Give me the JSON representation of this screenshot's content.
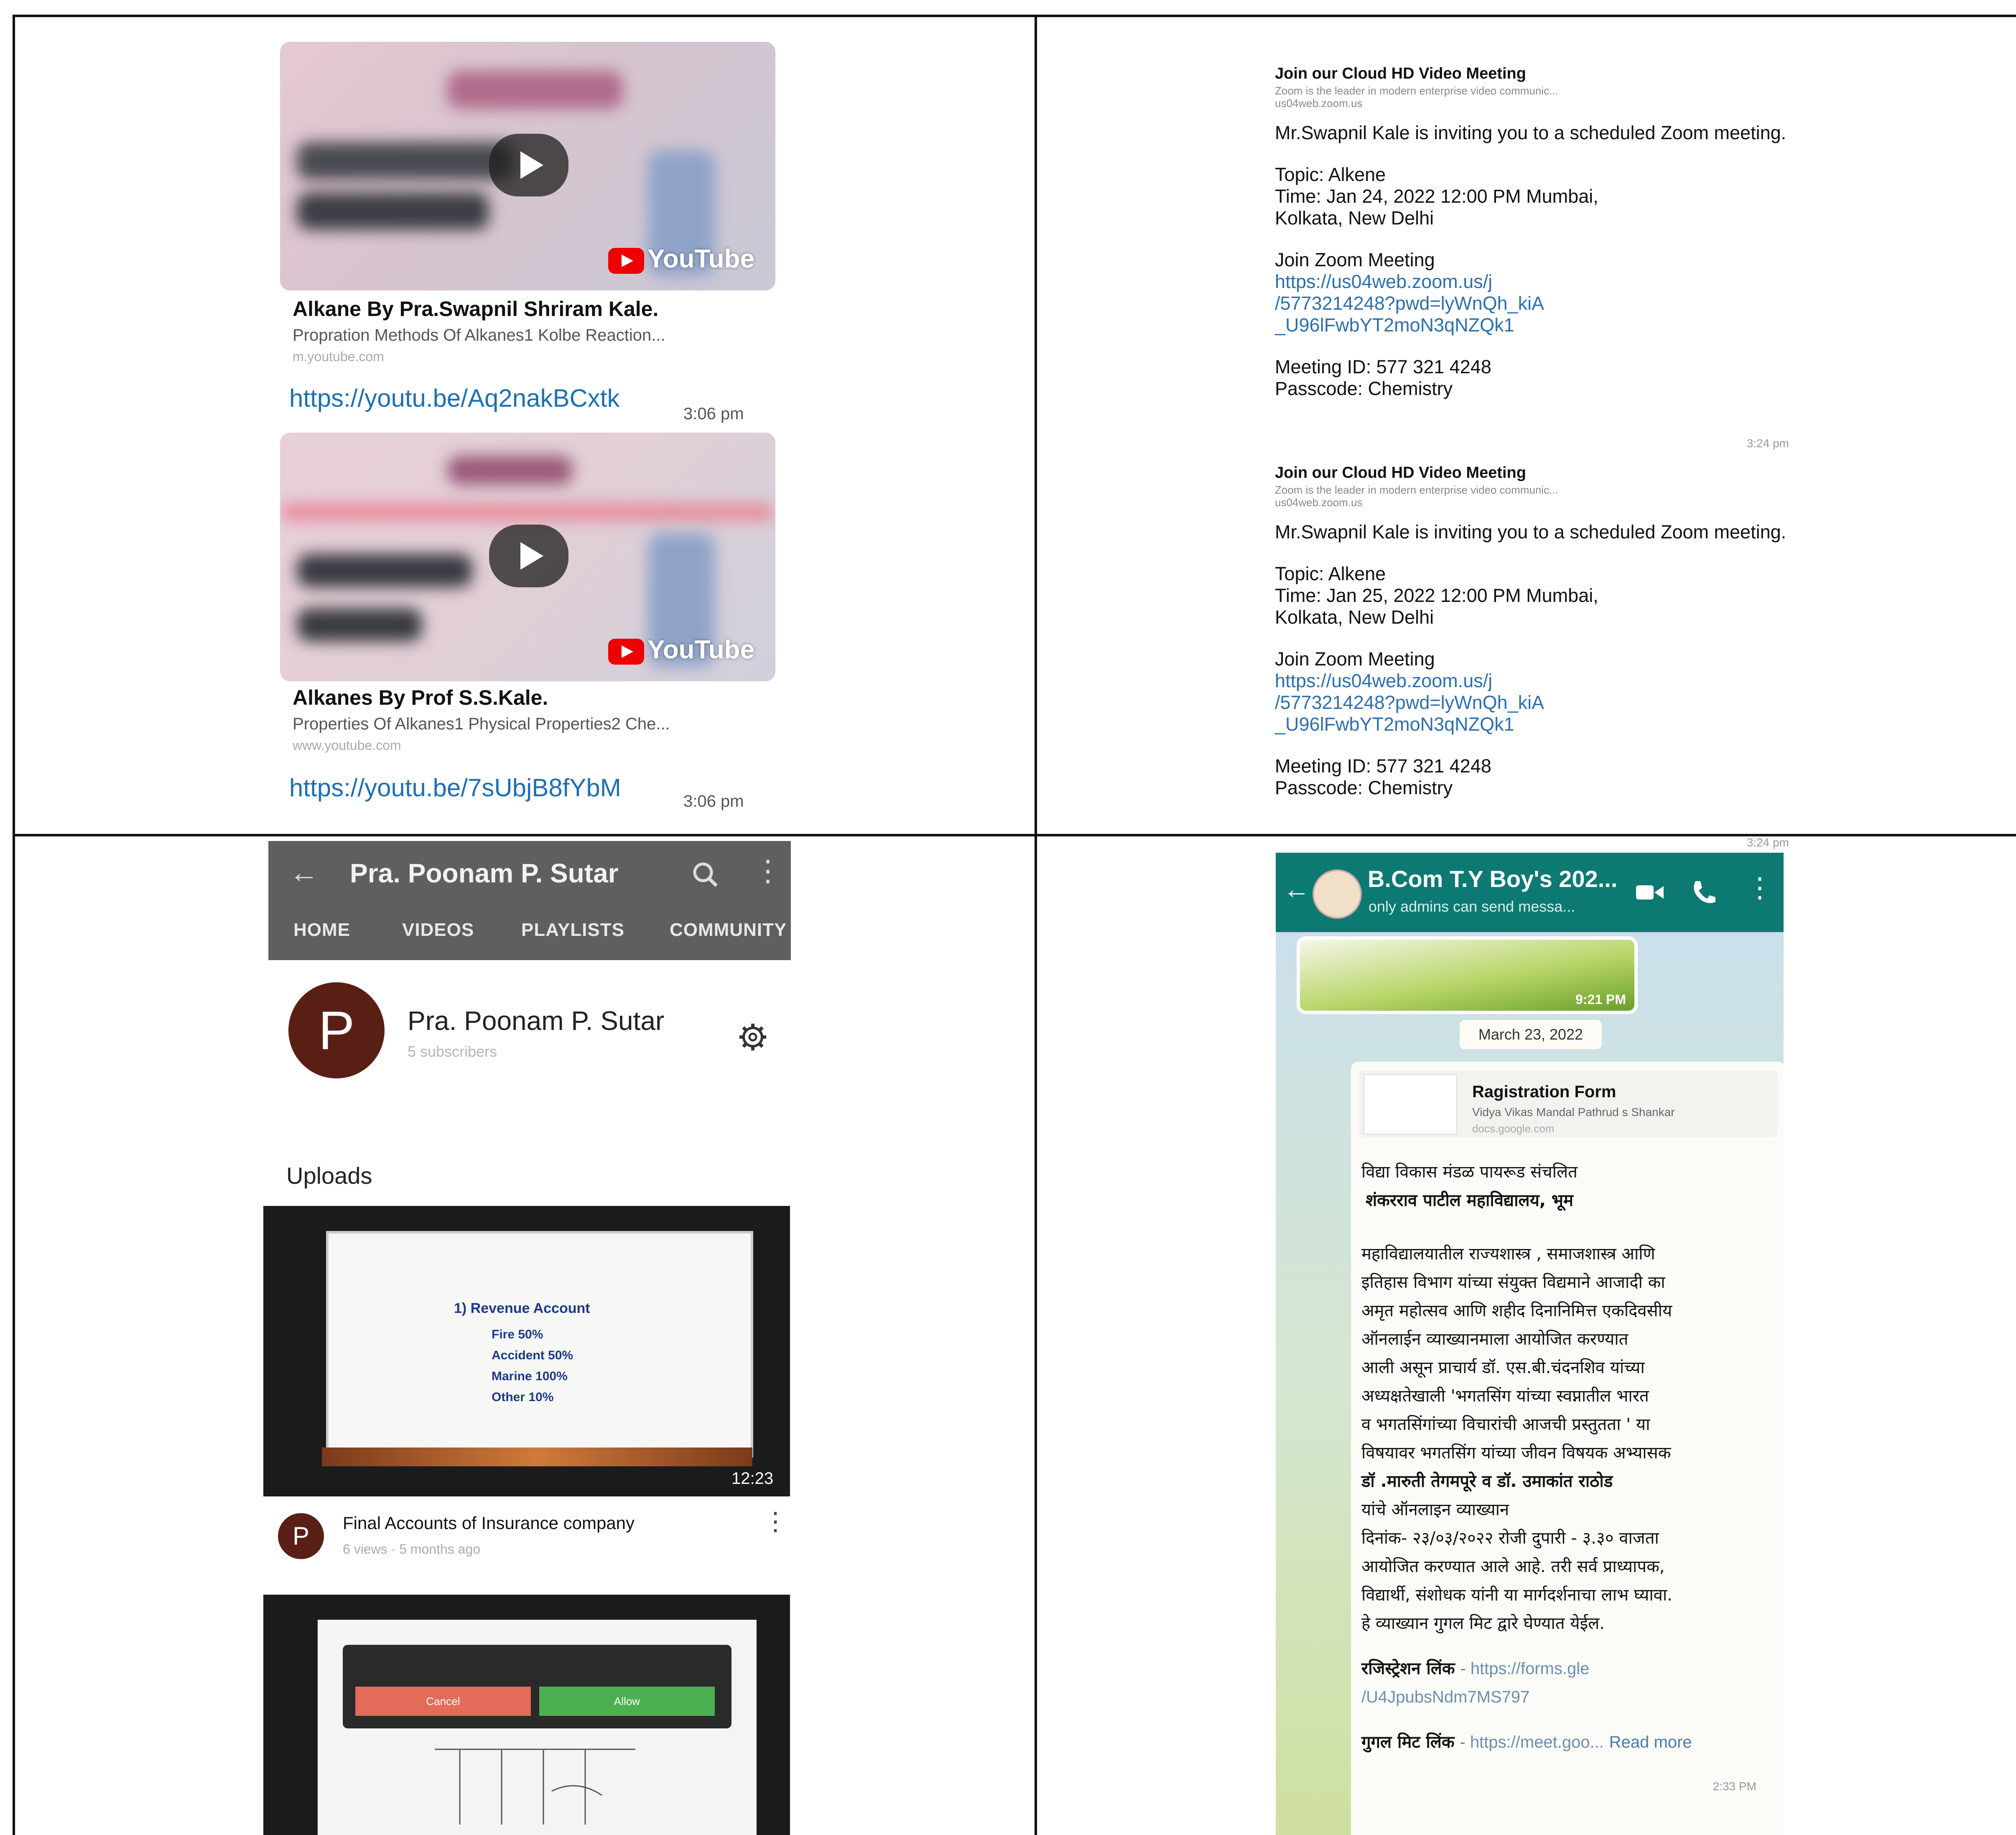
{
  "yt_links": [
    {
      "title": "Alkane By Pra.Swapnil Shriram Kale.",
      "description": "Propration Methods Of Alkanes1 Kolbe Reaction...",
      "site": "m.youtube.com",
      "url": "https://youtu.be/Aq2nakBCxtk",
      "time": "3:06 pm",
      "play_icon": "play-icon",
      "brand": "YouTube"
    },
    {
      "title": "Alkanes By Prof S.S.Kale.",
      "description": "Properties Of Alkanes1 Physical Properties2 Che...",
      "site": "www.youtube.com",
      "url": "https://youtu.be/7sUbjB8fYbM",
      "time": "3:06 pm",
      "play_icon": "play-icon",
      "brand": "YouTube"
    }
  ],
  "zoom_messages": [
    {
      "heading": "Join our Cloud HD Video Meeting",
      "subheading": "Zoom is the leader in modern enterprise video communic...",
      "site": "us04web.zoom.us",
      "invite": "Mr.Swapnil Kale is inviting you to a scheduled Zoom meeting.",
      "topic": "Topic: Alkene",
      "time_line1": "Time: Jan 24, 2022 12:00 PM Mumbai,",
      "time_line2": "Kolkata, New Delhi",
      "join_label": "Join Zoom Meeting",
      "url1": "https://us04web.zoom.us/j",
      "url2": "/5773214248?pwd=lyWnQh_kiA",
      "url3": "_U96lFwbYT2moN3qNZQk1",
      "meeting_id": "Meeting ID: 577 321 4248",
      "passcode": "Passcode: Chemistry",
      "sent_time": "3:24 pm"
    },
    {
      "heading": "Join our Cloud HD Video Meeting",
      "subheading": "Zoom is the leader in modern enterprise video communic...",
      "site": "us04web.zoom.us",
      "invite": "Mr.Swapnil Kale is inviting you to a scheduled Zoom meeting.",
      "topic": "Topic: Alkene",
      "time_line1": "Time: Jan 25, 2022 12:00 PM Mumbai,",
      "time_line2": "Kolkata, New Delhi",
      "join_label": "Join Zoom Meeting",
      "url1": "https://us04web.zoom.us/j",
      "url2": "/5773214248?pwd=lyWnQh_kiA",
      "url3": "_U96lFwbYT2moN3qNZQk1",
      "meeting_id": "Meeting ID: 577 321 4248",
      "passcode": "Passcode: Chemistry",
      "sent_time": "3:24 pm"
    }
  ],
  "channel": {
    "header_title": "Pra. Poonam P. Sutar",
    "back_icon": "back-arrow-icon",
    "search_icon": "search-icon",
    "menu_icon": "more-vert-icon",
    "tabs": [
      "HOME",
      "VIDEOS",
      "PLAYLISTS",
      "COMMUNITY"
    ],
    "avatar_letter": "P",
    "name": "Pra. Poonam P. Sutar",
    "subscribers": "5 subscribers",
    "settings_icon": "gear-icon",
    "uploads_label": "Uploads",
    "videos": [
      {
        "title": "Final Accounts of Insurance company",
        "meta": "6 views · 5 months ago",
        "duration": "12:23",
        "slide_heading": "1) Revenue Account",
        "slide_rows": [
          "Fire   50%",
          "Accident  50%",
          "Marine  100%",
          "Other  10%"
        ]
      },
      {
        "title": "",
        "meta": "",
        "slide_red": "Cancel",
        "slide_green": "Allow"
      }
    ]
  },
  "whatsapp": {
    "group_name": "B.Com T.Y Boy's 202...",
    "subtitle": "only admins can send messa...",
    "back_icon": "back-arrow-icon",
    "video_icon": "video-call-icon",
    "call_icon": "phone-icon",
    "menu_icon": "more-vert-icon",
    "image_time": "9:21 PM",
    "date_chip": "March 23, 2022",
    "link_title": "Ragistration Form",
    "link_desc": "Vidya Vikas Mandal Pathrud s Shankar",
    "link_site": "docs.google.com",
    "body": [
      "विद्या विकास मंडळ पायरूड संचलित",
      "शंकरराव पाटील महाविद्यालय, भूम",
      "महाविद्यालयातील राज्यशास्त्र , समाजशास्त्र आणि",
      "इतिहास  विभाग यांच्या संयुक्त विद्यमाने आजादी का",
      "अमृत महोत्सव आणि शहीद दिनानिमित्त एकदिवसीय",
      "ऑनलाईन व्याख्यानमाला आयोजित करण्यात",
      "आली असून प्राचार्य डॉ. एस.बी.चंदनशिव यांच्या",
      "अध्यक्षतेखाली 'भगतसिंग यांच्या स्वप्नातील भारत",
      "व भगतसिंगांच्या विचारांची आजची प्रस्तुतता ' या",
      "विषयावर भगतसिंग यांच्या जीवन विषयक अभ्यासक",
      "डॉ .मारुती तेगमपूरे व डॉ. उमाकांत राठोड",
      "यांचे ऑनलाइन व्याख्यान",
      "दिनांक- २३/०३/२०२२ रोजी दुपारी - ३.३० वाजता",
      "आयोजित करण्यात आले आहे. तरी सर्व प्राध्यापक,",
      "विद्यार्थी, संशोधक यांनी या मार्गदर्शनाचा लाभ घ्यावा.",
      "हे व्याख्यान गुगल मिट द्वारे घेण्यात येईल."
    ],
    "reg_label": "रजिस्ट्रेशन लिंक",
    "reg_url1": "https://forms.gle",
    "reg_url2": "/U4JpubsNdm7MS797",
    "meet_label": "गुगल मिट लिंक",
    "meet_url": "https://meet.goo...",
    "read_more": "Read more",
    "msg_time": "2:33 PM"
  }
}
